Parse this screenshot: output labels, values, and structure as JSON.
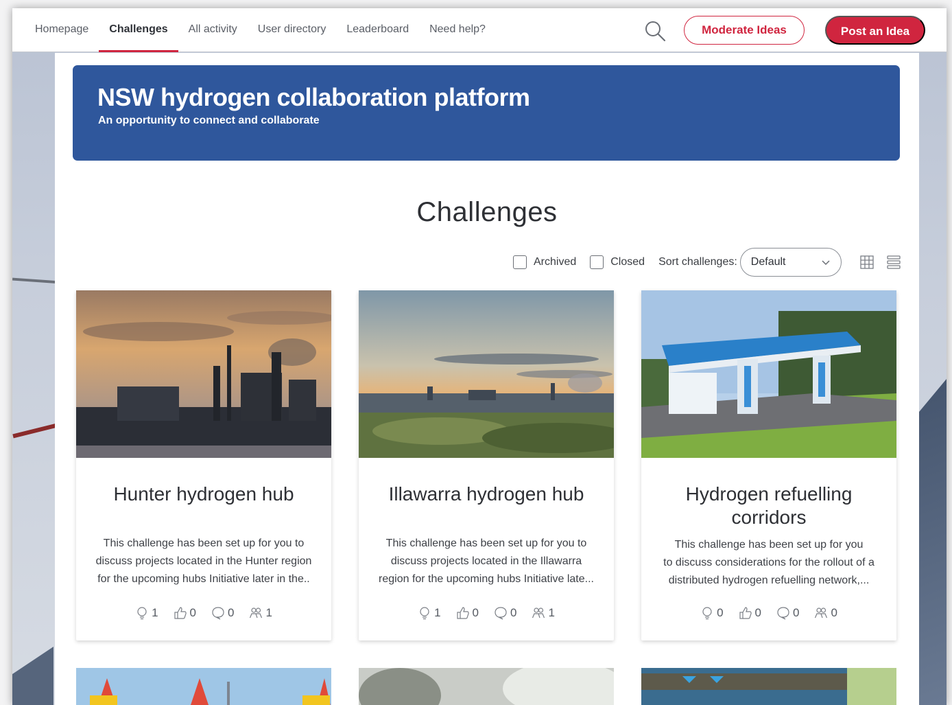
{
  "nav": {
    "links": [
      "Homepage",
      "Challenges",
      "All activity",
      "User directory",
      "Leaderboard",
      "Need help?"
    ],
    "active": "Challenges",
    "moderate_label": "Moderate Ideas",
    "post_label": "Post an Idea"
  },
  "banner": {
    "title": "NSW hydrogen collaboration platform",
    "subtitle": "An opportunity to connect and collaborate"
  },
  "page": {
    "heading": "Challenges"
  },
  "filters": {
    "archived_label": "Archived",
    "closed_label": "Closed",
    "sort_label": "Sort challenges:",
    "sort_value": "Default"
  },
  "cards": [
    {
      "title": "Hunter hydrogen hub",
      "desc_lines": [
        "This challenge has been set up for you to",
        "discuss projects located in the Hunter region",
        "for the upcoming hubs Initiative later in the.."
      ],
      "ideas": "1",
      "votes": "0",
      "comments": "0",
      "followers": "1"
    },
    {
      "title": "Illawarra hydrogen hub",
      "desc_lines": [
        "This challenge has been set up for you to",
        "discuss projects located in the Illawarra",
        "region for the upcoming hubs Initiative late..."
      ],
      "ideas": "1",
      "votes": "0",
      "comments": "0",
      "followers": "1"
    },
    {
      "title": "Hydrogen refuelling corridors",
      "title_lines": [
        "Hydrogen refuelling",
        "corridors"
      ],
      "desc_lines": [
        "This challenge has been set up for you",
        "to discuss considerations for the rollout of a",
        "distributed hydrogen refuelling network,..."
      ],
      "ideas": "0",
      "votes": "0",
      "comments": "0",
      "followers": "0"
    }
  ],
  "colors": {
    "accent": "#d0253f",
    "banner": "#2f579c"
  },
  "icons": [
    "search-icon",
    "chevron-down-icon",
    "grid-view-icon",
    "list-view-icon",
    "lightbulb-icon",
    "thumbs-up-icon",
    "comment-icon",
    "followers-icon"
  ]
}
